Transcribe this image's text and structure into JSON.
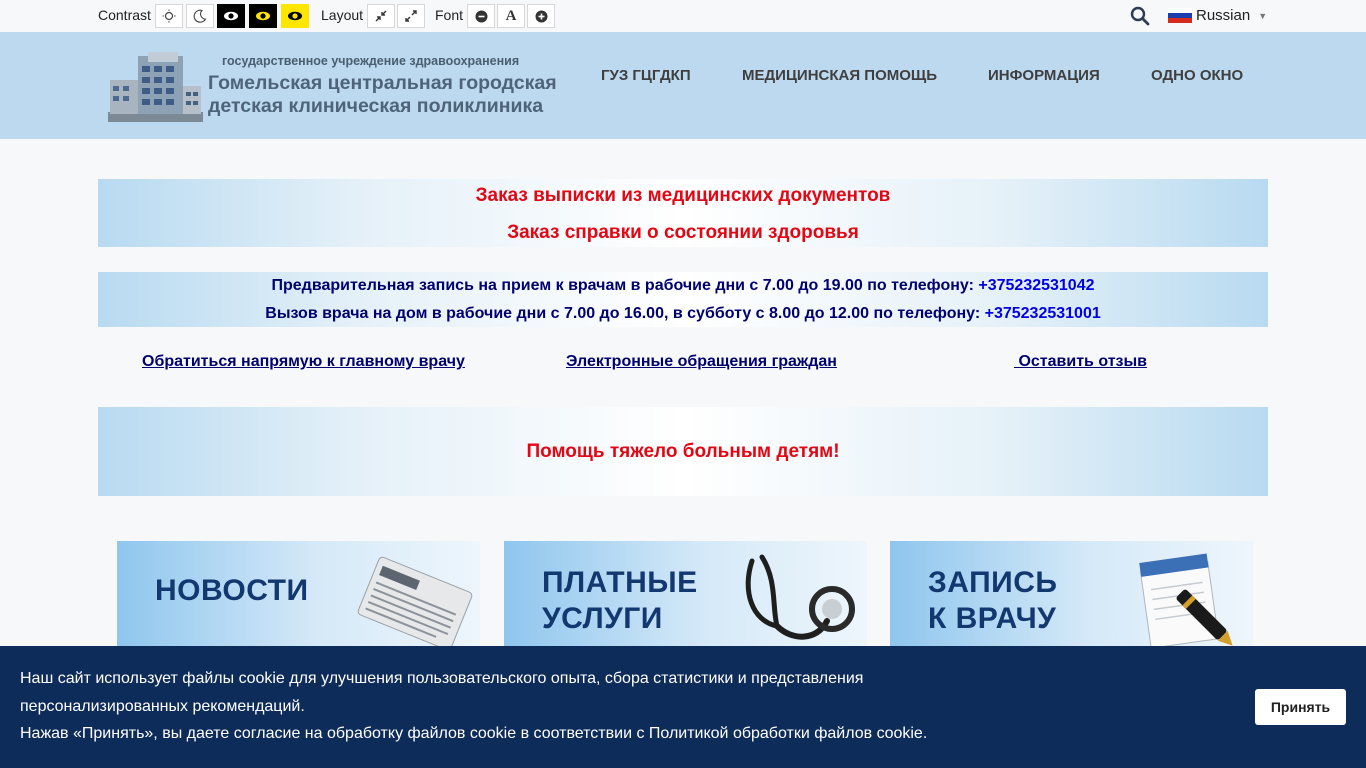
{
  "a11y": {
    "contrast_label": "Contrast",
    "layout_label": "Layout",
    "font_label": "Font",
    "language": "Russian"
  },
  "logo": {
    "line_small": "государственное учреждение здравоохранения",
    "line1": "Гомельская центральная городская",
    "line2": "детская клиническая поликлиника"
  },
  "nav": [
    {
      "label": "ГУЗ ГЦГДКП"
    },
    {
      "label": "МЕДИЦИНСКАЯ ПОМОЩЬ"
    },
    {
      "label": "ИНФОРМАЦИЯ"
    },
    {
      "label": "ОДНО ОКНО"
    }
  ],
  "box1": {
    "line1": "Заказ выписки из медицинских документов",
    "line2": "Заказ справки о состоянии здоровья"
  },
  "box2": {
    "line1_text": "Предварительная запись на прием к врачам в рабочие дни с 7.00 до 19.00 по телефону:",
    "line1_phone": "+375232531042",
    "line2_text": "Вызов врача на дом в рабочие дни с 7.00 до 16.00, в субботу с 8.00 до 12.00 по телефону:",
    "line2_phone": "+375232531001"
  },
  "links": [
    {
      "label": "Обратиться напрямую к главному врачу"
    },
    {
      "label": "Электронные обращения граждан"
    },
    {
      "label": " Оставить отзыв"
    }
  ],
  "box3": {
    "text": "Помощь тяжело больным детям!"
  },
  "tiles": [
    {
      "line1": "НОВОСТИ",
      "line2": ""
    },
    {
      "line1": "ПЛАТНЫЕ",
      "line2": "УСЛУГИ"
    },
    {
      "line1": "ЗАПИСЬ",
      "line2": "К ВРАЧУ"
    }
  ],
  "cookie": {
    "line1": "Наш сайт использует файлы cookie для улучшения пользовательского опыта, сбора статистики и представления",
    "line2": "персонализированных рекомендаций.",
    "line3": "Нажав «Принять», вы даете согласие на обработку файлов cookie в соответствии с Политикой обработки файлов cookie.",
    "accept_label": "Принять"
  },
  "colors": {
    "header_bg": "#bcd9ef",
    "accent_red": "#e30613",
    "navy_text": "#00006e",
    "phone_blue": "#0000e6",
    "cookie_bg": "#0e2c5a"
  }
}
